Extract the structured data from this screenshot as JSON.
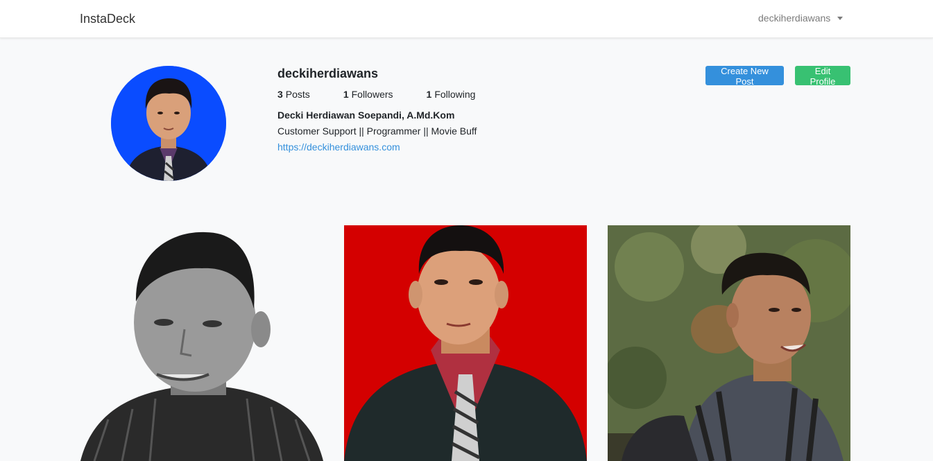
{
  "navbar": {
    "brand": "InstaDeck",
    "user_menu_label": "deckiherdiawans"
  },
  "profile": {
    "username": "deckiherdiawans",
    "stats": {
      "posts_count": "3",
      "posts_label": "Posts",
      "followers_count": "1",
      "followers_label": "Followers",
      "following_count": "1",
      "following_label": "Following"
    },
    "full_name": "Decki Herdiawan Soepandi, A.Md.Kom",
    "bio": "Customer Support || Programmer || Movie Buff",
    "website": "https://deckiherdiawans.com"
  },
  "actions": {
    "create_post_label": "Create New Post",
    "edit_profile_label": "Edit Profile"
  },
  "colors": {
    "primary": "#3490dc",
    "success": "#38c172",
    "page_background": "#f8f9fa"
  },
  "posts": [
    {
      "description": "grayscale portrait"
    },
    {
      "description": "portrait on red background"
    },
    {
      "description": "outdoor portrait with backpack"
    }
  ]
}
